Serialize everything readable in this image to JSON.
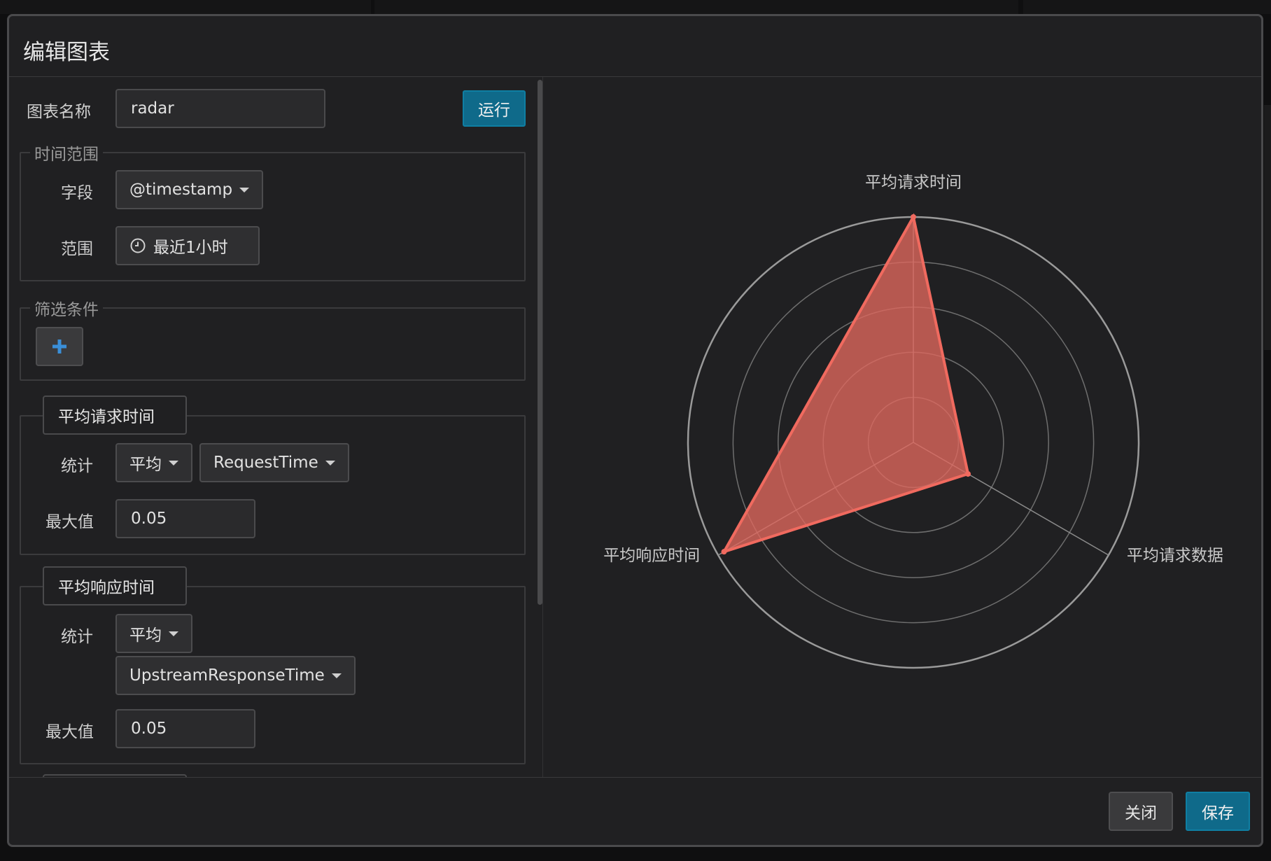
{
  "modal": {
    "title": "编辑图表"
  },
  "chart_name": {
    "label": "图表名称",
    "value": "radar",
    "run_label": "运行"
  },
  "time_range": {
    "legend": "时间范围",
    "field_label": "字段",
    "field_value": "@timestamp",
    "range_label": "范围",
    "range_value": "最近1小时",
    "range_icon": "clock-icon"
  },
  "filter": {
    "legend": "筛选条件",
    "add_icon": "plus-icon"
  },
  "metrics": [
    {
      "name": "平均请求时间",
      "stat_label": "统计",
      "agg": "平均",
      "field": "RequestTime",
      "max_label": "最大值",
      "max_value": "0.05"
    },
    {
      "name": "平均响应时间",
      "stat_label": "统计",
      "agg": "平均",
      "field": "UpstreamResponseTime",
      "max_label": "最大值",
      "max_value": "0.05"
    }
  ],
  "footer": {
    "close_label": "关闭",
    "save_label": "保存"
  },
  "colors": {
    "accent": "#0f6a8a",
    "series_fill": "#e0685e",
    "series_line": "#f06a5f"
  },
  "chart_data": {
    "type": "radar",
    "indicators": [
      "平均请求时间",
      "平均请求数据",
      "平均响应时间"
    ],
    "series": [
      {
        "values": [
          1.0,
          0.28,
          0.97
        ]
      }
    ],
    "rings": 5,
    "max": 1
  }
}
